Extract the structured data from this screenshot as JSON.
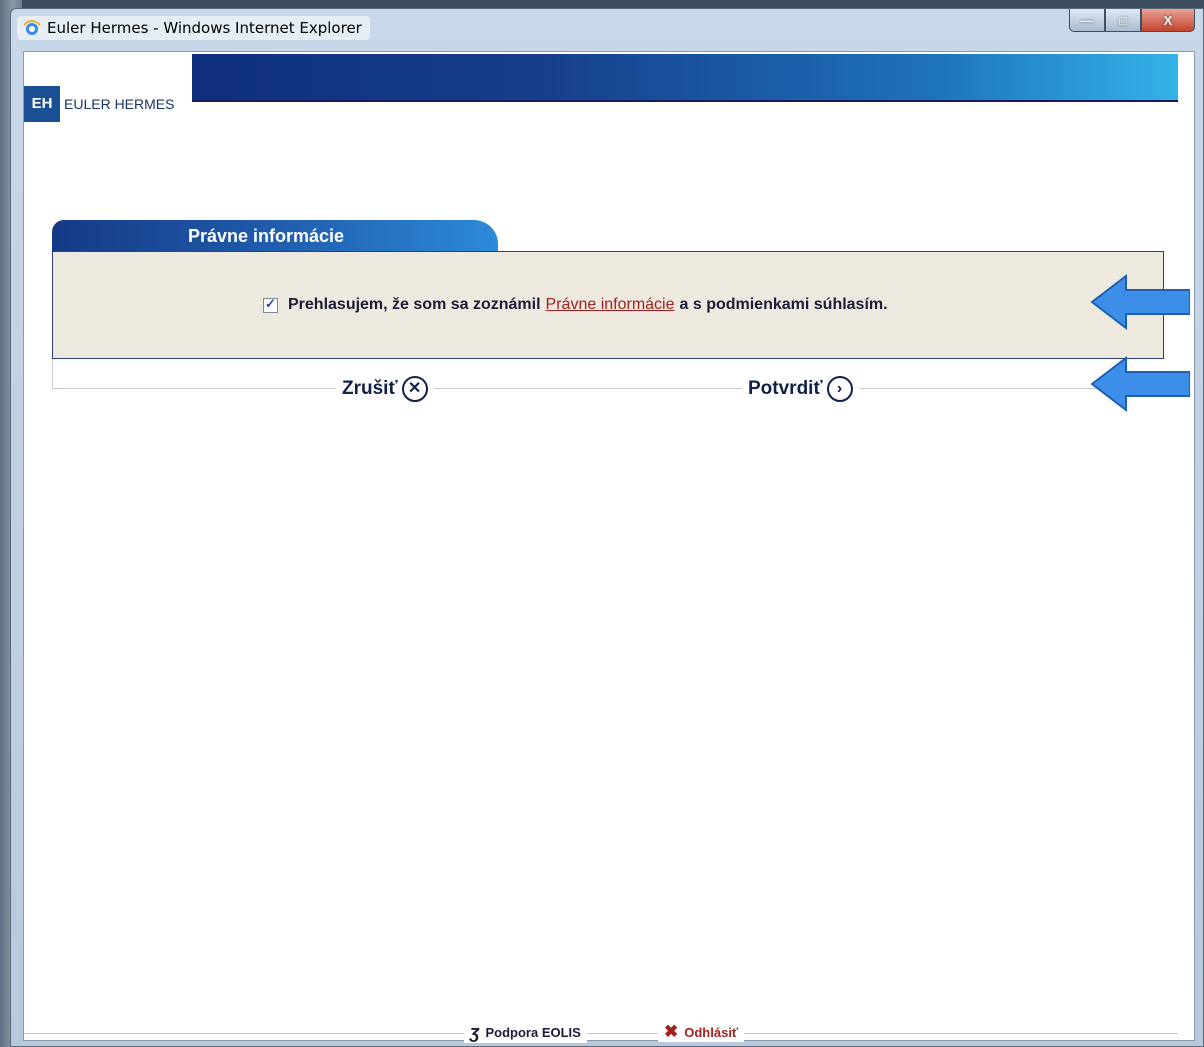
{
  "window": {
    "title": "Euler Hermes - Windows Internet Explorer",
    "controls": {
      "minimize": "—",
      "maximize": "□",
      "close": "X"
    }
  },
  "header": {
    "logo_mark": "EH",
    "logo_text": "EULER HERMES"
  },
  "panel": {
    "tab_title": "Právne informácie",
    "checkbox_checked": true,
    "consent_prefix": "Prehlasujem, že som sa zoznámil",
    "consent_link": "Právne informácie",
    "consent_suffix": "a s podmienkami súhlasím."
  },
  "actions": {
    "cancel_label": "Zrušiť",
    "cancel_icon": "close-circle-icon",
    "confirm_label": "Potvrdiť",
    "confirm_icon": "chevron-right-circle-icon"
  },
  "footer": {
    "support_label": "Podpora  EOLIS",
    "support_icon": "ear-icon",
    "logout_label": "Odhlásiť",
    "logout_icon": "x-icon"
  },
  "colors": {
    "accent_blue": "#1b4f93",
    "panel_bg": "#ede9de",
    "link_red": "#a32020",
    "annotation_arrow": "#3d8ee8"
  }
}
